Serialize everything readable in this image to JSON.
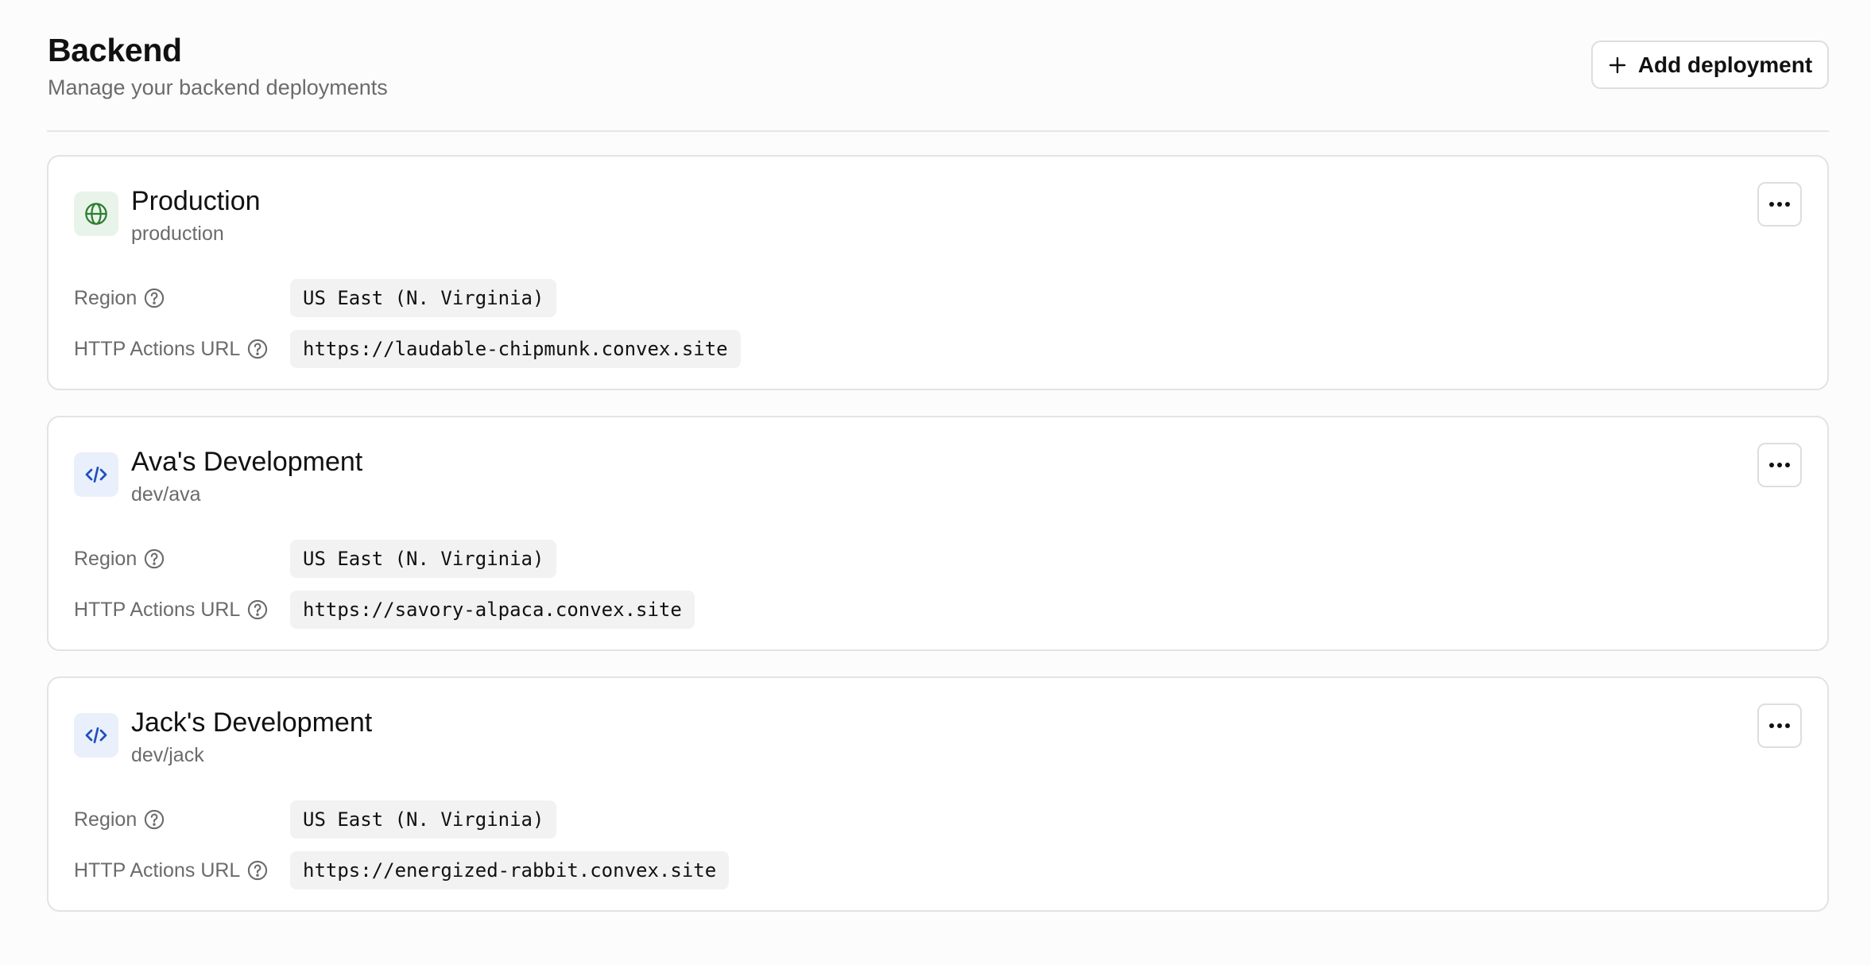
{
  "header": {
    "title": "Backend",
    "subtitle": "Manage your backend deployments",
    "add_button_label": "Add deployment"
  },
  "labels": {
    "region": "Region",
    "http_actions_url": "HTTP Actions URL"
  },
  "deployments": [
    {
      "name": "Production",
      "slug": "production",
      "icon": "globe-icon",
      "region": "US East (N. Virginia)",
      "http_actions_url": "https://laudable-chipmunk.convex.site"
    },
    {
      "name": "Ava's Development",
      "slug": "dev/ava",
      "icon": "code-icon",
      "region": "US East (N. Virginia)",
      "http_actions_url": "https://savory-alpaca.convex.site"
    },
    {
      "name": "Jack's Development",
      "slug": "dev/jack",
      "icon": "code-icon",
      "region": "US East (N. Virginia)",
      "http_actions_url": "https://energized-rabbit.convex.site"
    }
  ],
  "colors": {
    "background": "#fcfcfc",
    "card_border": "#e3e3e3",
    "muted_text": "#6b6b6b",
    "globe_icon_bg": "#e8f4ea",
    "globe_icon": "#2e7d32",
    "code_icon_bg": "#e9effb",
    "code_icon": "#1f4fbf",
    "pill_bg": "#f2f2f2"
  }
}
